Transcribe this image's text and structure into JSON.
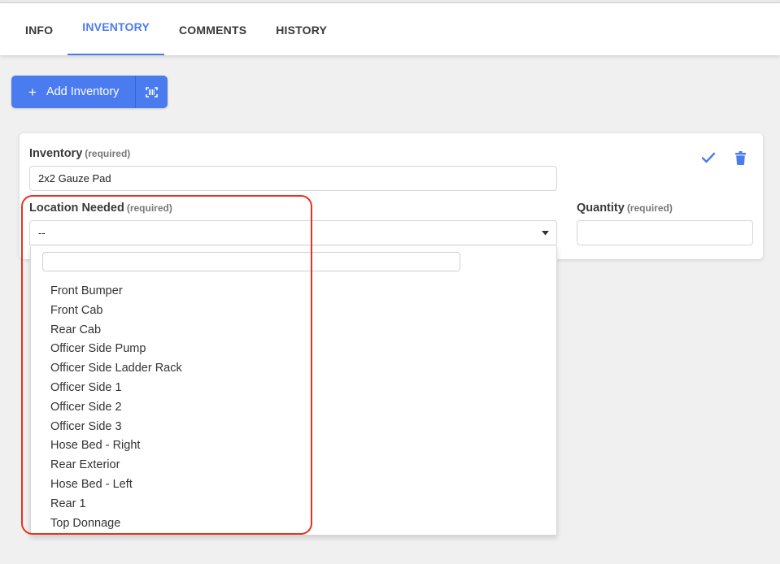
{
  "tabs": [
    {
      "label": "INFO",
      "active": false
    },
    {
      "label": "INVENTORY",
      "active": true
    },
    {
      "label": "COMMENTS",
      "active": false
    },
    {
      "label": "HISTORY",
      "active": false
    }
  ],
  "toolbar": {
    "add_icon": "+",
    "add_label": "Add Inventory",
    "scan_icon": "barcode-scan-icon"
  },
  "form": {
    "inventory": {
      "label": "Inventory",
      "required": "(required)",
      "value": "2x2 Gauze Pad"
    },
    "location": {
      "label": "Location Needed",
      "required": "(required)",
      "value": "--"
    },
    "quantity": {
      "label": "Quantity",
      "required": "(required)",
      "value": ""
    },
    "actions": {
      "confirm_icon": "check-icon",
      "delete_icon": "trash-icon"
    }
  },
  "dropdown": {
    "search_value": "",
    "options": [
      "Front Bumper",
      "Front Cab",
      "Rear Cab",
      "Officer Side Pump",
      "Officer Side Ladder Rack",
      "Officer Side 1",
      "Officer Side 2",
      "Officer Side 3",
      "Hose Bed - Right",
      "Rear Exterior",
      "Hose Bed - Left",
      "Rear 1",
      "Top Donnage"
    ]
  },
  "colors": {
    "accent": "#4a7cf0",
    "highlight": "#e8321f",
    "background": "#f0f0f0"
  }
}
